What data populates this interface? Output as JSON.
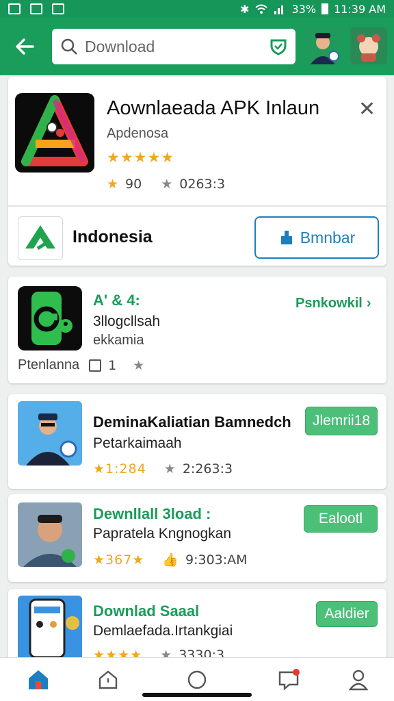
{
  "status_bar": {
    "time": "11:39 AM",
    "battery": "33%"
  },
  "search": {
    "placeholder": "Download"
  },
  "featured": {
    "title": "Aownlaeada APK Inlaun",
    "subtitle": "Apdenosa",
    "rating_stars": "★★★★★",
    "rating_value": "90",
    "downloads": "0263:3",
    "country_label": "Indonesia",
    "action_label": "Bmnbar"
  },
  "items": [
    {
      "title": "A' & 4:",
      "line1": "3llogcllsah",
      "line2": "ekkamia",
      "footer_label": "Ptenlanna",
      "count": "1",
      "action_label": "Psnkowkil"
    },
    {
      "title": "DeminaKaliatian Bamnedch",
      "line1": "Petarkaimaah",
      "rating": "★1:284",
      "meta": "2:263:3",
      "action_label": "Jlemrii18"
    },
    {
      "title": "Dewnllall 3load :",
      "line1": "Papratela Kngnogkan",
      "rating": "★367★",
      "meta": "9:303:AM",
      "action_label": "Ealootl"
    },
    {
      "title": "Downlad Saaal",
      "line1": "Demlaefada.Irtankgiai",
      "rating": "★★★★",
      "meta": "3330:3",
      "action_label": "Aaldier"
    }
  ],
  "colors": {
    "primary_green": "#1a9c5b",
    "button_green": "#4cbf79",
    "accent_blue": "#1c7fbd",
    "star_yellow": "#f0a81f"
  }
}
